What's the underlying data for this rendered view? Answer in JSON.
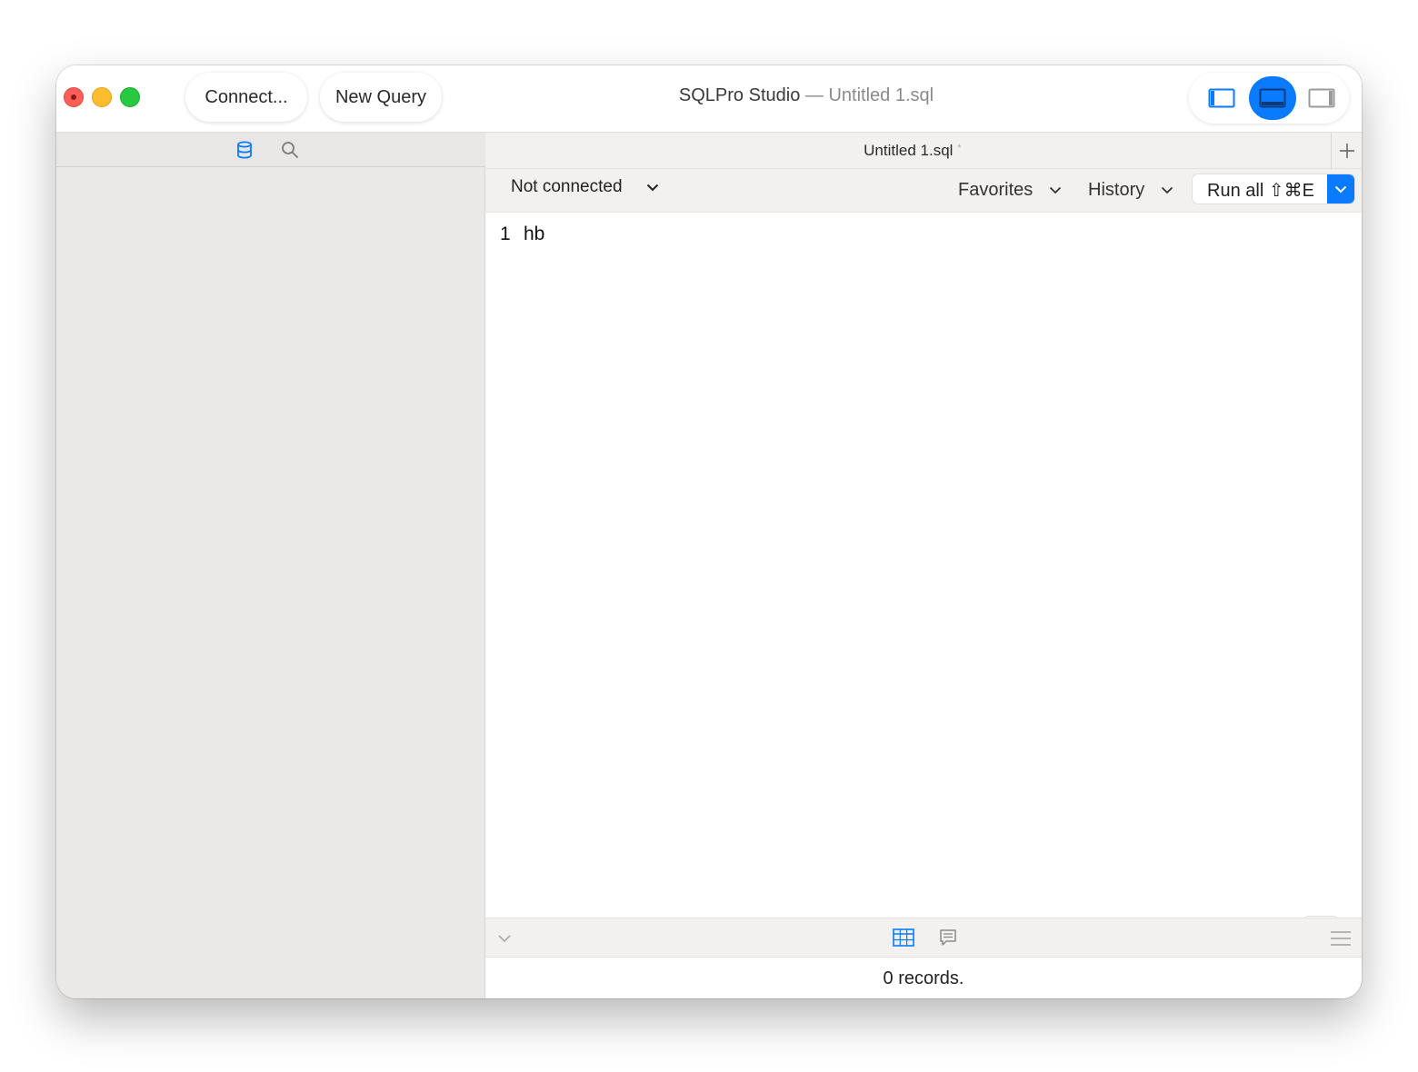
{
  "window": {
    "title": "SQLPro Studio",
    "separator": " — ",
    "document": "Untitled 1.sql"
  },
  "toolbar": {
    "connect_label": "Connect...",
    "new_query_label": "New Query"
  },
  "layout_toggles": {
    "active": "editor-only",
    "accent": "#0a7aff"
  },
  "sidebar": {
    "tabs": [
      "database-icon",
      "search-icon"
    ],
    "active_tab": "database-icon"
  },
  "doc_tab": {
    "title": "Untitled 1.sql",
    "dirty_marker": "*"
  },
  "query_toolbar": {
    "connection": "Not connected",
    "favorites": "Favorites",
    "history": "History",
    "run_all": "Run all ⇧⌘E"
  },
  "editor": {
    "lines": [
      {
        "number": "1",
        "text": "hb"
      }
    ]
  },
  "results": {
    "status": "0 records."
  },
  "colors": {
    "accent": "#0a7aff",
    "close": "#ff5f57",
    "minimize": "#febc2e",
    "zoom": "#28c840"
  }
}
